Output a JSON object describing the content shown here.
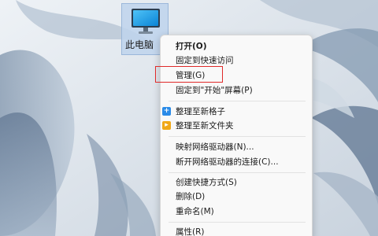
{
  "desktop": {
    "icon_label": "此电脑",
    "icon": "monitor-icon"
  },
  "context_menu": {
    "items": [
      {
        "label": "打开(O)",
        "bold": true
      },
      {
        "label": "固定到快速访问"
      },
      {
        "label": "管理(G)",
        "highlighted": true
      },
      {
        "label": "固定到\"开始\"屏幕(P)"
      },
      {
        "label": "整理至新格子",
        "icon": "blue-plus-icon"
      },
      {
        "label": "整理至新文件夹",
        "icon": "orange-folder-icon"
      },
      {
        "label": "映射网络驱动器(N)..."
      },
      {
        "label": "断开网络驱动器的连接(C)..."
      },
      {
        "label": "创建快捷方式(S)"
      },
      {
        "label": "删除(D)"
      },
      {
        "label": "重命名(M)"
      },
      {
        "label": "属性(R)"
      }
    ]
  },
  "colors": {
    "highlight_border": "#e02a2a",
    "menu_background": "#f9f9f9",
    "plus_icon": "#2a8be8",
    "folder_icon": "#f0a818"
  }
}
